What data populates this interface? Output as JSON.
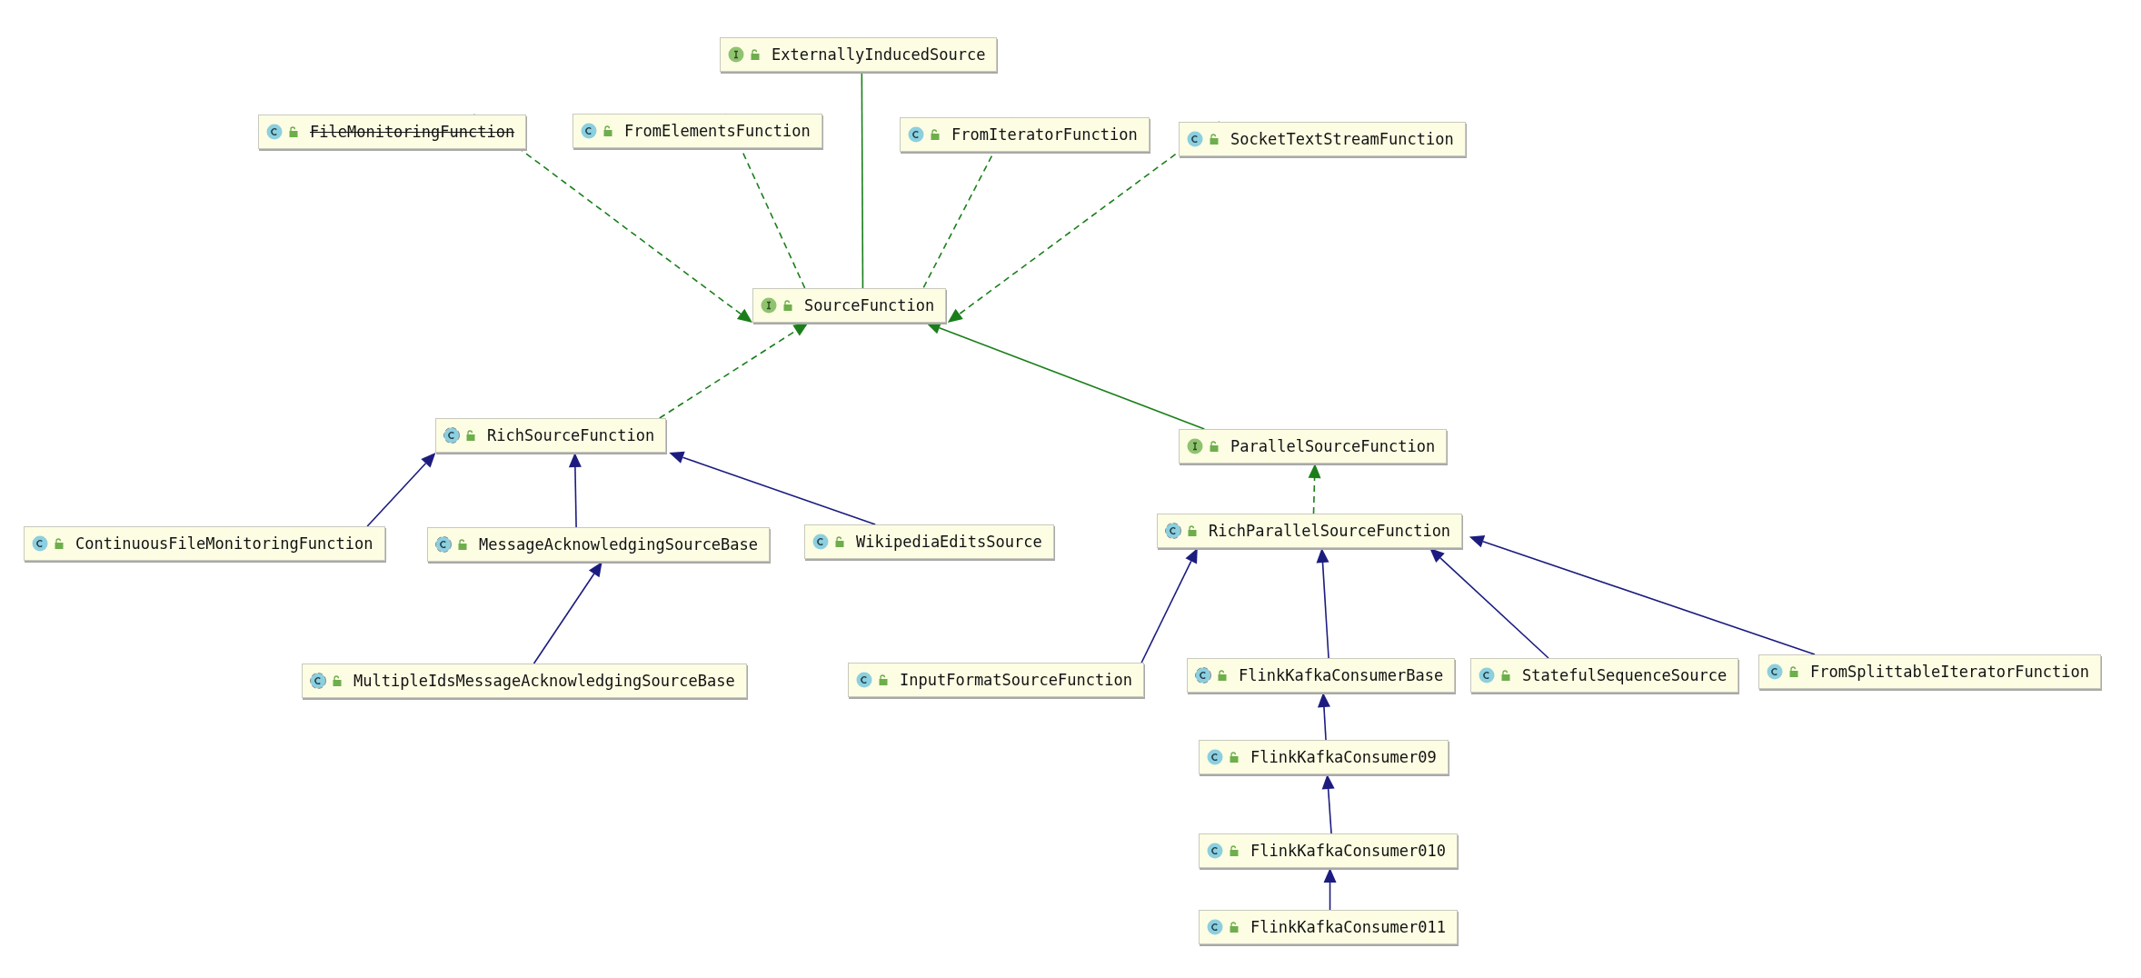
{
  "diagram": {
    "nodes": [
      {
        "name": "ExternallyInducedSource",
        "kind": "interface",
        "deprecated": false
      },
      {
        "name": "FileMonitoringFunction",
        "kind": "class",
        "deprecated": true
      },
      {
        "name": "FromElementsFunction",
        "kind": "class",
        "deprecated": false
      },
      {
        "name": "FromIteratorFunction",
        "kind": "class",
        "deprecated": false
      },
      {
        "name": "SocketTextStreamFunction",
        "kind": "class",
        "deprecated": false
      },
      {
        "name": "SourceFunction",
        "kind": "interface",
        "deprecated": false
      },
      {
        "name": "RichSourceFunction",
        "kind": "abstract",
        "deprecated": false
      },
      {
        "name": "ParallelSourceFunction",
        "kind": "interface",
        "deprecated": false
      },
      {
        "name": "ContinuousFileMonitoringFunction",
        "kind": "class",
        "deprecated": false
      },
      {
        "name": "MessageAcknowledgingSourceBase",
        "kind": "abstract",
        "deprecated": false
      },
      {
        "name": "WikipediaEditsSource",
        "kind": "class",
        "deprecated": false
      },
      {
        "name": "RichParallelSourceFunction",
        "kind": "abstract",
        "deprecated": false
      },
      {
        "name": "MultipleIdsMessageAcknowledgingSourceBase",
        "kind": "abstract",
        "deprecated": false
      },
      {
        "name": "InputFormatSourceFunction",
        "kind": "class",
        "deprecated": false
      },
      {
        "name": "FlinkKafkaConsumerBase",
        "kind": "abstract",
        "deprecated": false
      },
      {
        "name": "StatefulSequenceSource",
        "kind": "class",
        "deprecated": false
      },
      {
        "name": "FromSplittableIteratorFunction",
        "kind": "class",
        "deprecated": false
      },
      {
        "name": "FlinkKafkaConsumer09",
        "kind": "class",
        "deprecated": false
      },
      {
        "name": "FlinkKafkaConsumer010",
        "kind": "class",
        "deprecated": false
      },
      {
        "name": "FlinkKafkaConsumer011",
        "kind": "class",
        "deprecated": false
      }
    ],
    "edges": [
      {
        "kind": "implements"
      },
      {
        "kind": "implements"
      },
      {
        "kind": "interface-extends"
      },
      {
        "kind": "implements"
      },
      {
        "kind": "implements"
      },
      {
        "kind": "implements"
      },
      {
        "kind": "interface-extends"
      },
      {
        "kind": "extends"
      },
      {
        "kind": "extends"
      },
      {
        "kind": "extends"
      },
      {
        "kind": "implements"
      },
      {
        "kind": "extends"
      },
      {
        "kind": "extends"
      },
      {
        "kind": "extends"
      },
      {
        "kind": "extends"
      },
      {
        "kind": "extends"
      },
      {
        "kind": "extends"
      },
      {
        "kind": "extends"
      },
      {
        "kind": "extends"
      }
    ]
  }
}
